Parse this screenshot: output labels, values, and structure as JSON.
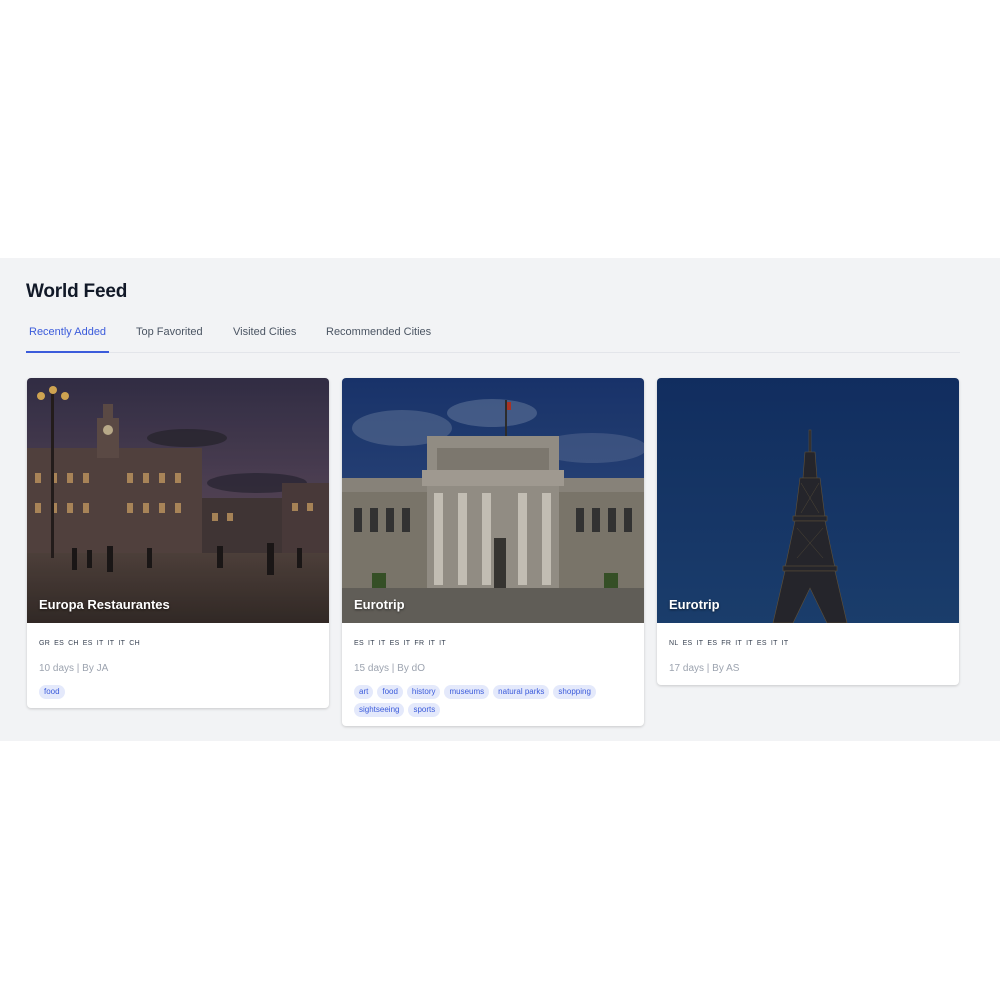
{
  "feed": {
    "title": "World Feed",
    "tabs": [
      {
        "label": "Recently Added",
        "active": true
      },
      {
        "label": "Top Favorited",
        "active": false
      },
      {
        "label": "Visited Cities",
        "active": false
      },
      {
        "label": "Recommended Cities",
        "active": false
      }
    ]
  },
  "cards": [
    {
      "title": "Europa Restaurantes",
      "image": "puerta-del-sol-night-photo",
      "flags": [
        "GR",
        "ES",
        "CH",
        "ES",
        "IT",
        "IT",
        "IT",
        "CH"
      ],
      "meta": "10 days | By JA",
      "tags": [
        "food"
      ]
    },
    {
      "title": "Eurotrip",
      "image": "prado-museum-photo",
      "flags": [
        "ES",
        "IT",
        "IT",
        "ES",
        "IT",
        "FR",
        "IT",
        "IT"
      ],
      "meta": "15 days | By dO",
      "tags": [
        "art",
        "food",
        "history",
        "museums",
        "natural parks",
        "shopping",
        "sightseeing",
        "sports"
      ]
    },
    {
      "title": "Eurotrip",
      "image": "eiffel-tower-photo",
      "flags": [
        "NL",
        "ES",
        "IT",
        "ES",
        "FR",
        "IT",
        "IT",
        "ES",
        "IT",
        "IT"
      ],
      "meta": "17 days | By AS",
      "tags": []
    }
  ],
  "colors": {
    "accent": "#3b5bdb",
    "tag_bg": "#e4e9fb",
    "feed_bg": "#f2f3f5"
  }
}
